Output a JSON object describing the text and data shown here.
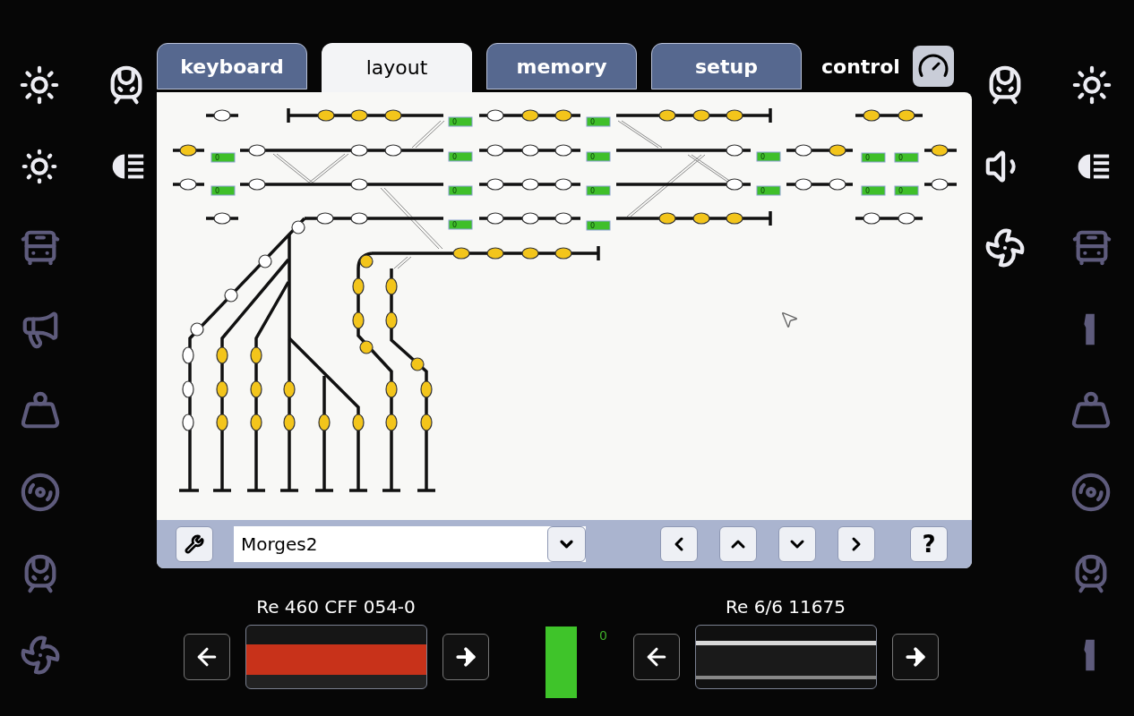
{
  "tabs": [
    {
      "label": "keyboard",
      "selected": false
    },
    {
      "label": "layout",
      "selected": true
    },
    {
      "label": "memory",
      "selected": false
    },
    {
      "label": "setup",
      "selected": false
    }
  ],
  "control": {
    "label": "control"
  },
  "left_functions": [
    {
      "items": [
        {
          "kind": "light",
          "on": true
        },
        {
          "kind": "train",
          "on": true
        }
      ]
    },
    {
      "items": [
        {
          "kind": "beam",
          "on": true
        },
        {
          "kind": "highbeam",
          "on": true
        }
      ]
    },
    {
      "items": [
        {
          "kind": "bus",
          "on": false
        }
      ]
    },
    {
      "items": [
        {
          "kind": "horn",
          "on": false
        }
      ]
    },
    {
      "items": [
        {
          "kind": "weight",
          "on": false
        }
      ]
    },
    {
      "items": [
        {
          "kind": "wheel",
          "on": false
        }
      ]
    },
    {
      "items": [
        {
          "kind": "train",
          "on": false
        }
      ]
    },
    {
      "items": [
        {
          "kind": "fan",
          "on": false
        }
      ]
    }
  ],
  "right_functions": [
    {
      "items": [
        {
          "kind": "train",
          "on": true
        },
        {
          "kind": "light",
          "on": true
        }
      ]
    },
    {
      "items": [
        {
          "kind": "speaker",
          "on": true
        },
        {
          "kind": "highbeam",
          "on": true
        }
      ]
    },
    {
      "items": [
        {
          "kind": "fan",
          "on": true
        },
        {
          "kind": "bus",
          "on": false
        }
      ]
    },
    {
      "items": [
        {
          "kind": "coupler",
          "on": false
        }
      ]
    },
    {
      "items": [
        {
          "kind": "weight",
          "on": false
        }
      ]
    },
    {
      "items": [
        {
          "kind": "wheel",
          "on": false
        }
      ]
    },
    {
      "items": [
        {
          "kind": "train",
          "on": false
        }
      ]
    },
    {
      "items": [
        {
          "kind": "coupler",
          "on": false
        }
      ]
    }
  ],
  "layout_tracks": [
    {
      "lamps": [
        {
          "lit": false
        }
      ]
    },
    {
      "lamps": [
        {
          "lit": true
        },
        {
          "lit": true
        },
        {
          "lit": true
        }
      ]
    },
    {
      "lamps": [
        {
          "lit": false
        },
        {
          "lit": true
        },
        {
          "lit": true
        }
      ]
    },
    {
      "lamps": [
        {
          "lit": true
        },
        {
          "lit": true
        },
        {
          "lit": true
        }
      ]
    },
    {
      "lamps": [
        {
          "lit": true
        },
        {
          "lit": true
        }
      ]
    },
    {
      "lamps": [
        {
          "lit": true
        }
      ]
    },
    {
      "lamps": [
        {
          "lit": false
        },
        {
          "lit": false
        },
        {
          "lit": false
        }
      ]
    },
    {
      "lamps": [
        {
          "lit": false
        },
        {
          "lit": false
        },
        {
          "lit": false
        }
      ]
    },
    {
      "lamps": [
        {
          "lit": false
        }
      ]
    },
    {
      "lamps": [
        {
          "lit": false
        },
        {
          "lit": true
        }
      ]
    },
    {
      "lamps": [
        {
          "lit": true
        }
      ]
    },
    {
      "lamps": [
        {
          "lit": false
        }
      ]
    },
    {
      "lamps": [
        {
          "lit": false
        },
        {
          "lit": false
        }
      ]
    },
    {
      "lamps": [
        {
          "lit": false
        },
        {
          "lit": false
        },
        {
          "lit": false
        }
      ]
    },
    {
      "lamps": [
        {
          "lit": false
        }
      ]
    },
    {
      "lamps": [
        {
          "lit": false
        },
        {
          "lit": false
        }
      ]
    },
    {
      "lamps": [
        {
          "lit": false
        }
      ]
    },
    {
      "lamps": [
        {
          "lit": false
        }
      ]
    },
    {
      "lamps": [
        {
          "lit": false
        },
        {
          "lit": false
        }
      ]
    },
    {
      "lamps": [
        {
          "lit": false
        },
        {
          "lit": false
        },
        {
          "lit": false
        },
        {
          "lit": false
        },
        {
          "lit": false
        },
        {
          "lit": false
        },
        {
          "lit": false
        }
      ]
    },
    {
      "lamps": [
        {
          "lit": false
        },
        {
          "lit": false
        },
        {
          "lit": false
        }
      ]
    },
    {
      "lamps": [
        {
          "lit": true
        },
        {
          "lit": true
        },
        {
          "lit": true
        }
      ]
    },
    {
      "lamps": [
        {
          "lit": false
        },
        {
          "lit": false
        }
      ]
    },
    {
      "lamps": [
        {
          "lit": true
        },
        {
          "lit": true
        },
        {
          "lit": true
        },
        {
          "lit": true
        }
      ]
    },
    {
      "lamps": [
        {
          "lit": true
        },
        {
          "lit": true
        },
        {
          "lit": true
        }
      ]
    },
    {
      "lamps": [
        {
          "lit": true
        },
        {
          "lit": true
        },
        {
          "lit": true
        }
      ]
    },
    {
      "lamps": [
        {
          "lit": true
        },
        {
          "lit": true
        }
      ]
    },
    {
      "lamps": [
        {
          "lit": true
        }
      ]
    },
    {
      "lamps": [
        {
          "lit": true
        }
      ]
    },
    {
      "lamps": [
        {
          "lit": true
        },
        {
          "lit": true
        },
        {
          "lit": true
        },
        {
          "lit": true
        },
        {
          "lit": true
        },
        {
          "lit": true
        }
      ]
    },
    {
      "lamps": [
        {
          "lit": true
        },
        {
          "lit": true
        },
        {
          "lit": true
        },
        {
          "lit": true
        },
        {
          "lit": true
        }
      ]
    }
  ],
  "block_counters": [
    {
      "text": "0"
    },
    {
      "text": "0"
    },
    {
      "text": "0"
    },
    {
      "text": "0"
    },
    {
      "text": "0"
    },
    {
      "text": "0"
    },
    {
      "text": "0"
    },
    {
      "text": "0"
    },
    {
      "text": "0"
    },
    {
      "text": "0"
    },
    {
      "text": "0"
    },
    {
      "text": "0"
    },
    {
      "text": "0"
    },
    {
      "text": "0"
    },
    {
      "text": "0"
    },
    {
      "text": "0"
    }
  ],
  "toolbar": {
    "layout_name": "Morges2",
    "help": "?"
  },
  "locos": [
    {
      "name": "Re 460 CFF 054-0",
      "kind": "red"
    },
    {
      "name": "Re 6/6 11675",
      "kind": "dark"
    }
  ],
  "speed_meter": {
    "level": 1,
    "readout": "0"
  }
}
